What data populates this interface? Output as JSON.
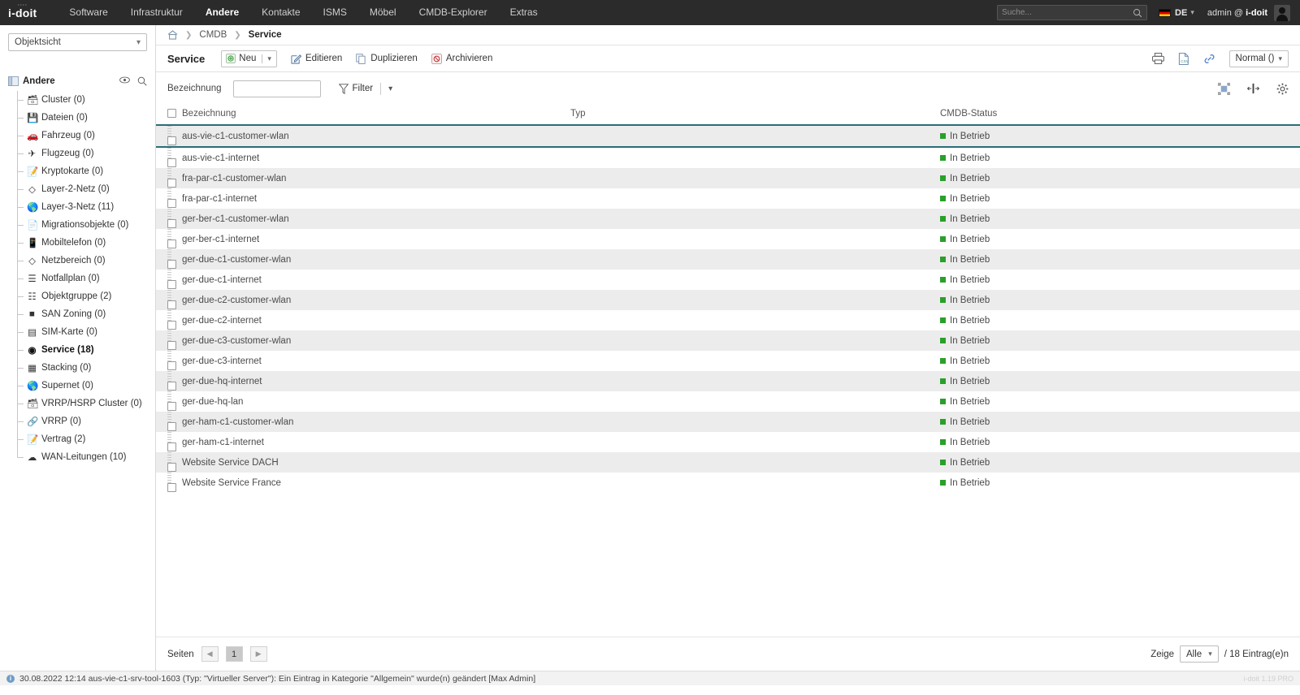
{
  "topnav": {
    "logo": "i-doit",
    "items": [
      {
        "label": "Software",
        "active": false
      },
      {
        "label": "Infrastruktur",
        "active": false
      },
      {
        "label": "Andere",
        "active": true
      },
      {
        "label": "Kontakte",
        "active": false
      },
      {
        "label": "ISMS",
        "active": false
      },
      {
        "label": "Möbel",
        "active": false
      },
      {
        "label": "CMDB-Explorer",
        "active": false
      },
      {
        "label": "Extras",
        "active": false
      }
    ],
    "search_placeholder": "Suche...",
    "language": "DE",
    "user_prefix": "admin @ ",
    "user_tenant": "i-doit"
  },
  "sidebar": {
    "view_select": "Objektsicht",
    "root_label": "Andere",
    "items": [
      {
        "label": "Cluster (0)",
        "icon": "cluster-icon"
      },
      {
        "label": "Dateien (0)",
        "icon": "file-save-icon"
      },
      {
        "label": "Fahrzeug (0)",
        "icon": "car-icon"
      },
      {
        "label": "Flugzeug (0)",
        "icon": "plane-icon"
      },
      {
        "label": "Kryptokarte (0)",
        "icon": "crypto-card-icon"
      },
      {
        "label": "Layer-2-Netz (0)",
        "icon": "layer2-icon"
      },
      {
        "label": "Layer-3-Netz (11)",
        "icon": "layer3-icon"
      },
      {
        "label": "Migrationsobjekte (0)",
        "icon": "document-icon"
      },
      {
        "label": "Mobiltelefon (0)",
        "icon": "mobile-icon"
      },
      {
        "label": "Netzbereich (0)",
        "icon": "netrange-icon"
      },
      {
        "label": "Notfallplan (0)",
        "icon": "emergency-plan-icon"
      },
      {
        "label": "Objektgruppe (2)",
        "icon": "object-group-icon"
      },
      {
        "label": "SAN Zoning (0)",
        "icon": "san-zoning-icon"
      },
      {
        "label": "SIM-Karte (0)",
        "icon": "sim-card-icon"
      },
      {
        "label": "Service (18)",
        "icon": "service-icon",
        "selected": true
      },
      {
        "label": "Stacking (0)",
        "icon": "stacking-icon"
      },
      {
        "label": "Supernet (0)",
        "icon": "supernet-icon"
      },
      {
        "label": "VRRP/HSRP Cluster (0)",
        "icon": "vrrp-cluster-icon"
      },
      {
        "label": "VRRP (0)",
        "icon": "vrrp-icon"
      },
      {
        "label": "Vertrag (2)",
        "icon": "contract-icon"
      },
      {
        "label": "WAN-Leitungen (10)",
        "icon": "wan-icon"
      }
    ]
  },
  "breadcrumb": {
    "home": "home-icon",
    "items": [
      "CMDB"
    ],
    "current": "Service"
  },
  "toolbar": {
    "title": "Service",
    "new_label": "Neu",
    "edit_label": "Editieren",
    "duplicate_label": "Duplizieren",
    "archive_label": "Archivieren",
    "view_mode": "Normal ()"
  },
  "filter": {
    "label": "Bezeichnung",
    "input_value": "",
    "input_placeholder": "",
    "filter_label": "Filter"
  },
  "table": {
    "columns": [
      "Bezeichnung",
      "Typ",
      "CMDB-Status"
    ],
    "rows": [
      {
        "name": "aus-vie-c1-customer-wlan",
        "typ": "",
        "status": "In Betrieb"
      },
      {
        "name": "aus-vie-c1-internet",
        "typ": "",
        "status": "In Betrieb"
      },
      {
        "name": "fra-par-c1-customer-wlan",
        "typ": "",
        "status": "In Betrieb"
      },
      {
        "name": "fra-par-c1-internet",
        "typ": "",
        "status": "In Betrieb"
      },
      {
        "name": "ger-ber-c1-customer-wlan",
        "typ": "",
        "status": "In Betrieb"
      },
      {
        "name": "ger-ber-c1-internet",
        "typ": "",
        "status": "In Betrieb"
      },
      {
        "name": "ger-due-c1-customer-wlan",
        "typ": "",
        "status": "In Betrieb"
      },
      {
        "name": "ger-due-c1-internet",
        "typ": "",
        "status": "In Betrieb"
      },
      {
        "name": "ger-due-c2-customer-wlan",
        "typ": "",
        "status": "In Betrieb"
      },
      {
        "name": "ger-due-c2-internet",
        "typ": "",
        "status": "In Betrieb"
      },
      {
        "name": "ger-due-c3-customer-wlan",
        "typ": "",
        "status": "In Betrieb"
      },
      {
        "name": "ger-due-c3-internet",
        "typ": "",
        "status": "In Betrieb"
      },
      {
        "name": "ger-due-hq-internet",
        "typ": "",
        "status": "In Betrieb"
      },
      {
        "name": "ger-due-hq-lan",
        "typ": "",
        "status": "In Betrieb"
      },
      {
        "name": "ger-ham-c1-customer-wlan",
        "typ": "",
        "status": "In Betrieb"
      },
      {
        "name": "ger-ham-c1-internet",
        "typ": "",
        "status": "In Betrieb"
      },
      {
        "name": "Website Service DACH",
        "typ": "",
        "status": "In Betrieb"
      },
      {
        "name": "Website Service France",
        "typ": "",
        "status": "In Betrieb"
      }
    ]
  },
  "footer": {
    "pages_label": "Seiten",
    "current_page": "1",
    "show_label": "Zeige",
    "show_value": "Alle",
    "entries_label": "/ 18 Eintrag(e)n"
  },
  "statusbar": {
    "message": "30.08.2022 12:14 aus-vie-c1-srv-tool-1603 (Typ: \"Virtueller Server\"): Ein Eintrag in Kategorie \"Allgemein\" wurde(n) geändert [Max Admin]",
    "version": "i-doit 1.19 PRO"
  },
  "colors": {
    "nav_bg": "#2b2b2b",
    "accent": "#2a6e77",
    "status_green": "#2aa02a",
    "row_alt": "#ececec"
  }
}
